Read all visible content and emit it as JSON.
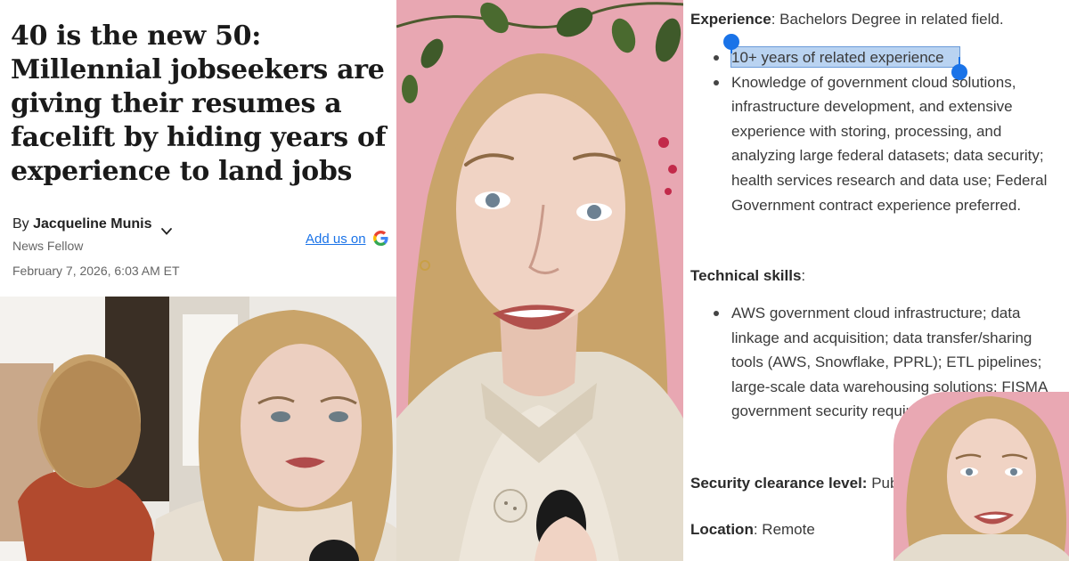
{
  "article": {
    "headline": "40 is the new 50: Millennial jobseekers are giving their resumes a facelift by hiding years of experience to land jobs",
    "by_prefix": "By",
    "author": "Jacqueline Munis",
    "author_role": "News Fellow",
    "add_us_label": "Add us on",
    "google_icon": "google-g-icon",
    "date": "February 7, 2026, 6:03 AM ET"
  },
  "job_post": {
    "experience_label": "Experience",
    "experience_value": ": Bachelors Degree in related field.",
    "experience_items": [
      "10+ years of related experience",
      "Knowledge of government cloud solutions, infrastructure development, and extensive experience with storing, processing, and analyzing large federal datasets; data security; health services research and data use; Federal Government contract experience preferred."
    ],
    "technical_label": "Technical skills",
    "technical_suffix": ":",
    "technical_items": [
      "AWS government cloud infrastructure; data linkage and acquisition; data transfer/sharing tools (AWS, Snowflake, PPRL); ETL pipelines; large-scale data warehousing solutions; FISMA government security requirem"
    ],
    "clearance_label": "Security clearance level:",
    "clearance_value": " Public Tr",
    "location_label": "Location",
    "location_value": ": Remote"
  },
  "colors": {
    "link": "#1a73e8",
    "selection_fill": "#b9d3f1",
    "wall_pink": "#e8a7b2",
    "sweater": "#e4dccd",
    "hair": "#c9a46a"
  }
}
